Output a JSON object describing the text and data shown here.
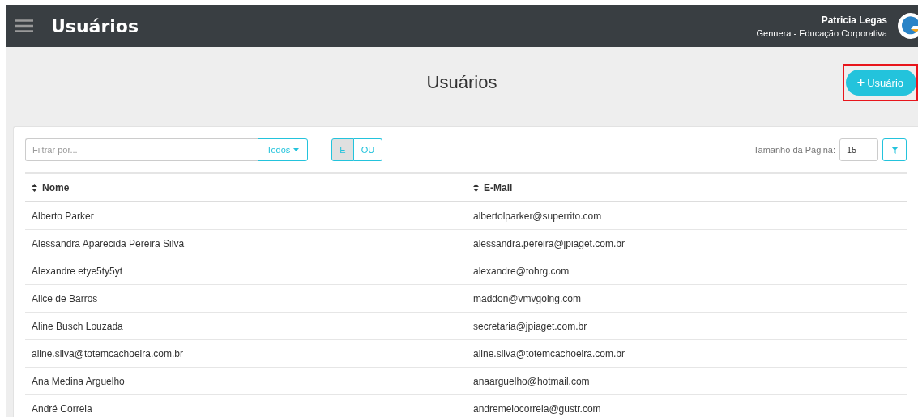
{
  "header": {
    "title": "Usuários",
    "user_name": "Patricia Legas",
    "organization": "Gennera - Educação Corporativa"
  },
  "page_title": "Usuários",
  "add_button": {
    "icon": "+",
    "label": "Usuário",
    "highlighted": true
  },
  "filter": {
    "placeholder": "Filtrar por...",
    "scope": "Todos",
    "logic": [
      {
        "label": "E",
        "selected": true
      },
      {
        "label": "OU",
        "selected": false
      }
    ],
    "page_size_label": "Tamanho da Página:",
    "page_size": "15"
  },
  "table": {
    "columns": [
      "Nome",
      "E-Mail"
    ],
    "rows": [
      [
        "Alberto Parker",
        "albertolparker@superrito.com"
      ],
      [
        "Alessandra Aparecida Pereira Silva",
        "alessandra.pereira@jpiaget.com.br"
      ],
      [
        "Alexandre etye5ty5yt",
        "alexandre@tohrg.com"
      ],
      [
        "Alice de Barros",
        "maddon@vmvgoing.com"
      ],
      [
        "Aline Busch Louzada",
        "secretaria@jpiaget.com.br"
      ],
      [
        "aline.silva@totemcachoeira.com.br",
        "aline.silva@totemcachoeira.com.br"
      ],
      [
        "Ana Medina Arguelho",
        "anaarguelho@hotmail.com"
      ],
      [
        "André Correia",
        "andremelocorreia@gustr.com"
      ]
    ]
  }
}
